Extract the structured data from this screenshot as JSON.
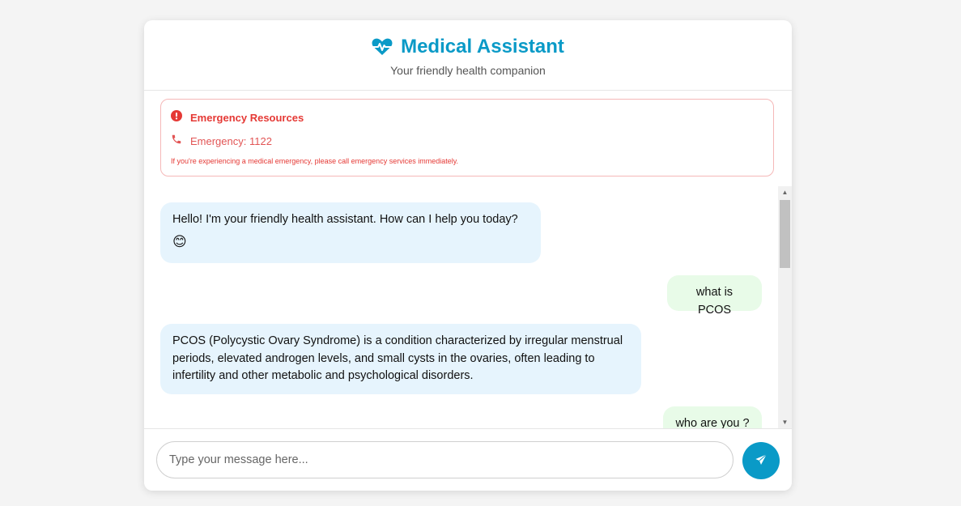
{
  "header": {
    "title": "Medical Assistant",
    "subtitle": "Your friendly health companion",
    "icon": "heartbeat-icon"
  },
  "emergency": {
    "title": "Emergency Resources",
    "phone": "Emergency: 1122",
    "note": "If you're experiencing a medical emergency, please call emergency services immediately."
  },
  "messages": [
    {
      "role": "bot",
      "text": "Hello! I'm your friendly health assistant. How can I help you today?",
      "emoji": "😊"
    },
    {
      "role": "user",
      "text": "what is PCOS"
    },
    {
      "role": "bot",
      "text": "PCOS (Polycystic Ovary Syndrome) is a condition characterized by irregular menstrual periods, elevated androgen levels, and small cysts in the ovaries, often leading to infertility and other metabolic and psychological disorders."
    },
    {
      "role": "user",
      "text": "who are you ?"
    }
  ],
  "composer": {
    "placeholder": "Type your message here...",
    "send_icon": "paper-plane-icon"
  },
  "colors": {
    "accent": "#0a9ac7",
    "emergency": "#e53935",
    "bot_bubble": "#e6f4fd",
    "user_bubble": "#e8fbe8"
  }
}
